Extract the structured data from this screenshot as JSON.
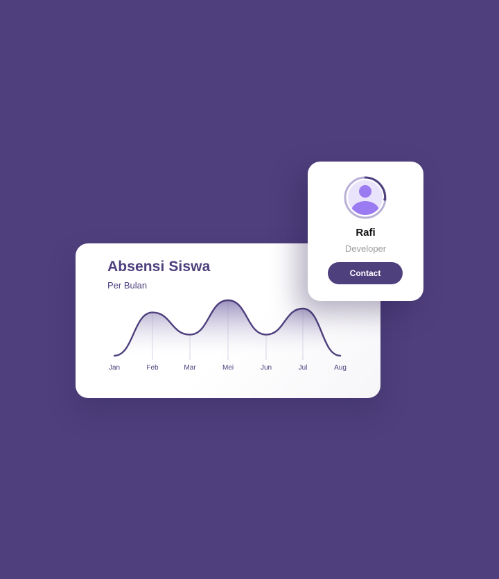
{
  "colors": {
    "background": "#4f407d",
    "accent": "#4e3f7d",
    "avatar_fill": "#9b7bf1",
    "card": "#ffffff"
  },
  "attendance_card": {
    "title": "Absensi Siswa",
    "subtitle": "Per Bulan"
  },
  "chart_data": {
    "type": "area",
    "title": "Absensi Siswa",
    "subtitle": "Per Bulan",
    "categories": [
      "Jan",
      "Feb",
      "Mar",
      "Mei",
      "Jun",
      "Jul",
      "Aug"
    ],
    "values": [
      0,
      0.78,
      0.38,
      1.0,
      0.38,
      0.85,
      0
    ],
    "grid": "vertical lines at Feb, Mar, Mei, Jun, Jul",
    "legend": "none"
  },
  "profile_card": {
    "name": "Rafi",
    "role": "Developer",
    "contact_label": "Contact",
    "avatar_icon": "user-avatar-icon"
  }
}
